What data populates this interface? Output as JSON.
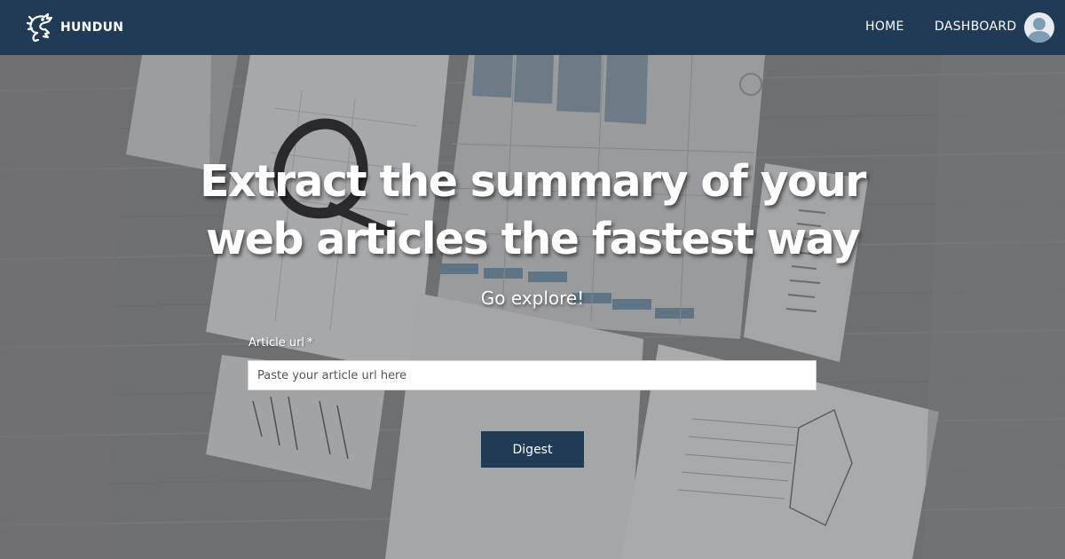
{
  "brand": {
    "name": "HUNDUN",
    "logo_icon": "dragon-logo-icon"
  },
  "nav": {
    "home_label": "HOME",
    "dashboard_label": "DASHBOARD",
    "avatar_icon": "user-avatar-icon"
  },
  "hero": {
    "headline_line1": "Extract the summary of your",
    "headline_line2": "web articles the fastest way",
    "subheadline": "Go explore!",
    "background_image": "desk-with-papers-photo"
  },
  "form": {
    "url_label": "Article url",
    "required_marker": "*",
    "url_value": "",
    "url_placeholder": "Paste your article url here",
    "submit_label": "Digest"
  },
  "colors": {
    "navbar": "#213a56",
    "button": "#213a56",
    "text_light": "#ffffff"
  }
}
